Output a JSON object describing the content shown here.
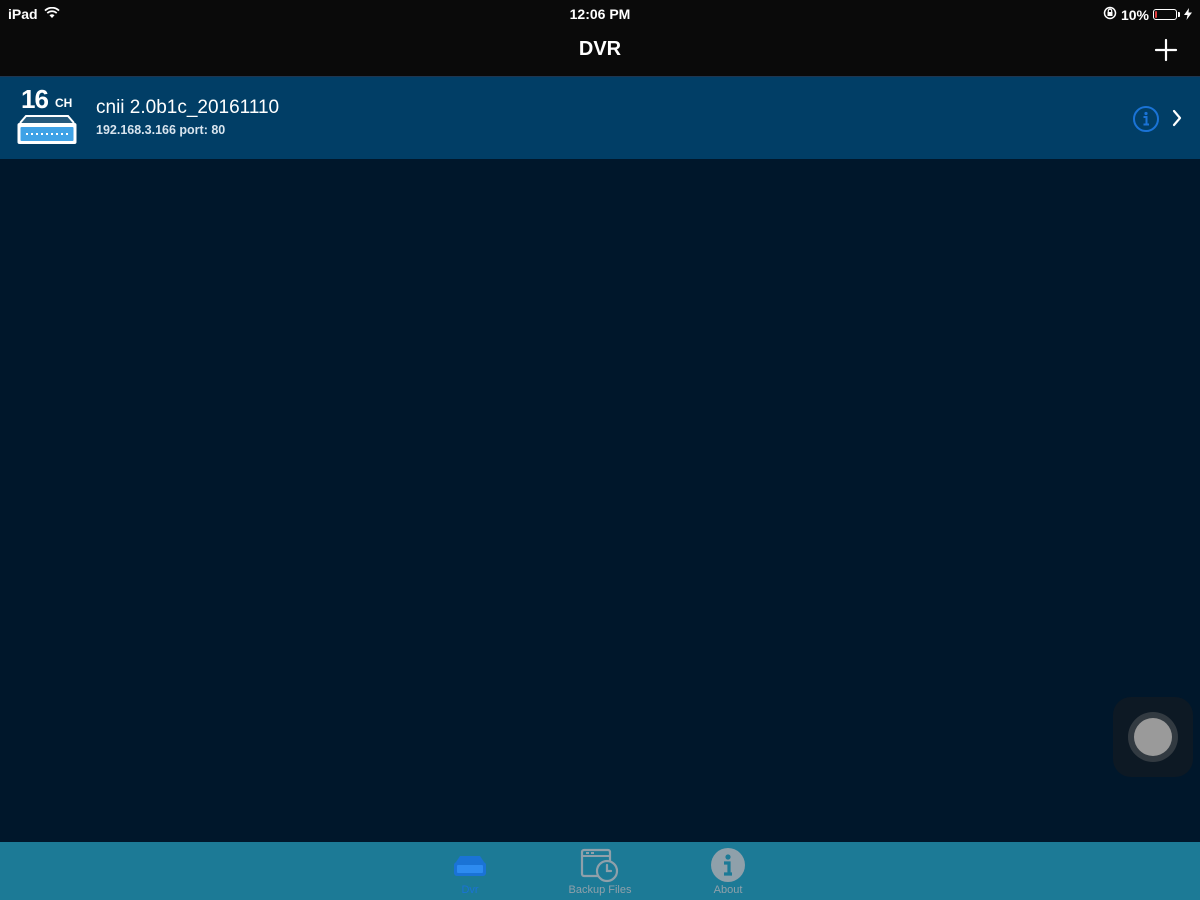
{
  "status_bar": {
    "device": "iPad",
    "time": "12:06 PM",
    "battery_percent_label": "10%",
    "battery_level": 0.1,
    "icons": [
      "wifi-icon",
      "orientation-lock-icon",
      "battery-icon",
      "charging-icon"
    ]
  },
  "nav": {
    "title": "DVR",
    "add_icon": "plus-icon"
  },
  "devices": [
    {
      "channels": "16",
      "channel_unit": "CH",
      "name": "cnii 2.0b1c_20161110",
      "address": "192.168.3.166 port: 80",
      "info_icon": "info-icon",
      "chevron_icon": "chevron-right-icon"
    }
  ],
  "tabs": [
    {
      "label": "Dvr",
      "icon": "dvr-device-icon",
      "active": true
    },
    {
      "label": "Backup Files",
      "icon": "backup-files-icon",
      "active": false
    },
    {
      "label": "About",
      "icon": "about-info-icon",
      "active": false
    }
  ],
  "colors": {
    "background": "#00172b",
    "bars": "#0a0a0a",
    "selected_row": "#013e66",
    "tab_bar": "#1c7a96",
    "accent_blue": "#1a73d6",
    "battery_low": "#e23b3b"
  }
}
